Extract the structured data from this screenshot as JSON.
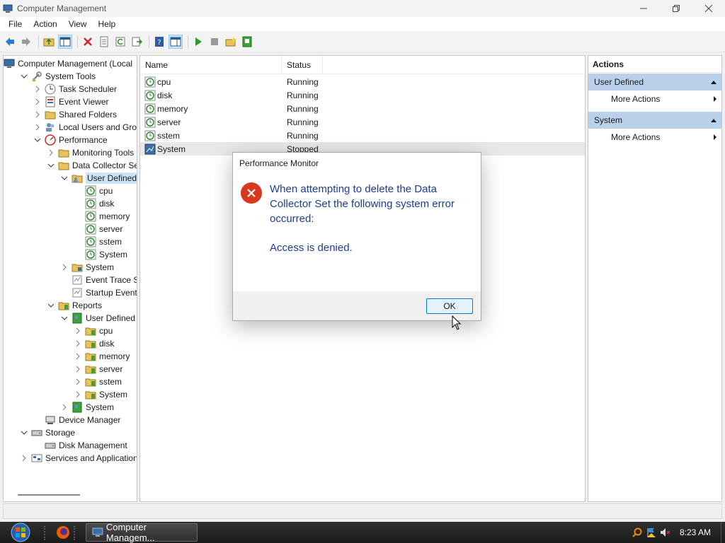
{
  "window": {
    "title": "Computer Management"
  },
  "menu": [
    "File",
    "Action",
    "View",
    "Help"
  ],
  "tree": [
    {
      "label": "Computer Management (Local",
      "level": 0,
      "chevron": "none",
      "icon": "computer-management-icon"
    },
    {
      "label": "System Tools",
      "level": 1,
      "chevron": "down",
      "icon": "system-tools-icon"
    },
    {
      "label": "Task Scheduler",
      "level": 2,
      "chevron": "right",
      "icon": "clock-icon"
    },
    {
      "label": "Event Viewer",
      "level": 2,
      "chevron": "right",
      "icon": "event-viewer-icon"
    },
    {
      "label": "Shared Folders",
      "level": 2,
      "chevron": "right",
      "icon": "shared-folder-icon"
    },
    {
      "label": "Local Users and Groups",
      "level": 2,
      "chevron": "right",
      "icon": "users-icon"
    },
    {
      "label": "Performance",
      "level": 2,
      "chevron": "down",
      "icon": "performance-icon"
    },
    {
      "label": "Monitoring Tools",
      "level": 3,
      "chevron": "right",
      "icon": "folder-icon"
    },
    {
      "label": "Data Collector Sets",
      "level": 3,
      "chevron": "down",
      "icon": "folder-icon"
    },
    {
      "label": "User Defined",
      "level": 4,
      "chevron": "down",
      "icon": "user-folder-icon",
      "selected": true
    },
    {
      "label": "cpu",
      "level": 5,
      "chevron": "none",
      "icon": "collector-icon"
    },
    {
      "label": "disk",
      "level": 5,
      "chevron": "none",
      "icon": "collector-icon"
    },
    {
      "label": "memory",
      "level": 5,
      "chevron": "none",
      "icon": "collector-icon"
    },
    {
      "label": "server",
      "level": 5,
      "chevron": "none",
      "icon": "collector-icon"
    },
    {
      "label": "sstem",
      "level": 5,
      "chevron": "none",
      "icon": "collector-icon"
    },
    {
      "label": "System",
      "level": 5,
      "chevron": "none",
      "icon": "collector-icon"
    },
    {
      "label": "System",
      "level": 4,
      "chevron": "right",
      "icon": "system-folder-icon"
    },
    {
      "label": "Event Trace Sess",
      "level": 4,
      "chevron": "none",
      "icon": "trace-icon"
    },
    {
      "label": "Startup Event Tra",
      "level": 4,
      "chevron": "none",
      "icon": "trace-icon"
    },
    {
      "label": "Reports",
      "level": 3,
      "chevron": "down",
      "icon": "report-folder-icon"
    },
    {
      "label": "User Defined",
      "level": 4,
      "chevron": "down",
      "icon": "report-user-icon"
    },
    {
      "label": "cpu",
      "level": 5,
      "chevron": "right",
      "icon": "report-folder-icon"
    },
    {
      "label": "disk",
      "level": 5,
      "chevron": "right",
      "icon": "report-folder-icon"
    },
    {
      "label": "memory",
      "level": 5,
      "chevron": "right",
      "icon": "report-folder-icon"
    },
    {
      "label": "server",
      "level": 5,
      "chevron": "right",
      "icon": "report-folder-icon"
    },
    {
      "label": "sstem",
      "level": 5,
      "chevron": "right",
      "icon": "report-folder-icon"
    },
    {
      "label": "System",
      "level": 5,
      "chevron": "right",
      "icon": "report-folder-icon"
    },
    {
      "label": "System",
      "level": 4,
      "chevron": "right",
      "icon": "report-system-icon"
    },
    {
      "label": "Device Manager",
      "level": 2,
      "chevron": "none",
      "icon": "device-manager-icon"
    },
    {
      "label": "Storage",
      "level": 1,
      "chevron": "down",
      "icon": "storage-icon"
    },
    {
      "label": "Disk Management",
      "level": 2,
      "chevron": "none",
      "icon": "disk-icon"
    },
    {
      "label": "Services and Applications",
      "level": 1,
      "chevron": "right",
      "icon": "services-icon"
    }
  ],
  "list": {
    "columns": [
      "Name",
      "Status"
    ],
    "rows": [
      {
        "name": "cpu",
        "status": "Running"
      },
      {
        "name": "disk",
        "status": "Running"
      },
      {
        "name": "memory",
        "status": "Running"
      },
      {
        "name": "server",
        "status": "Running"
      },
      {
        "name": "sstem",
        "status": "Running"
      },
      {
        "name": "System",
        "status": "Stopped",
        "highlight": true
      }
    ]
  },
  "actions": {
    "title": "Actions",
    "groups": [
      {
        "name": "User Defined",
        "item": "More Actions"
      },
      {
        "name": "System",
        "item": "More Actions"
      }
    ]
  },
  "dialog": {
    "title": "Performance Monitor",
    "message": "When attempting to delete the Data Collector Set the following system error occurred:",
    "detail": "Access is denied.",
    "ok_label": "OK",
    "icon": "error-icon"
  },
  "taskbar": {
    "task_label": "Computer Managem...",
    "clock": "8:23 AM"
  },
  "colors": {
    "selection": "#cce4f7",
    "actions_group": "#b9d1ea",
    "dialog_text": "#1d3d8c",
    "error_red": "#d9381e"
  }
}
